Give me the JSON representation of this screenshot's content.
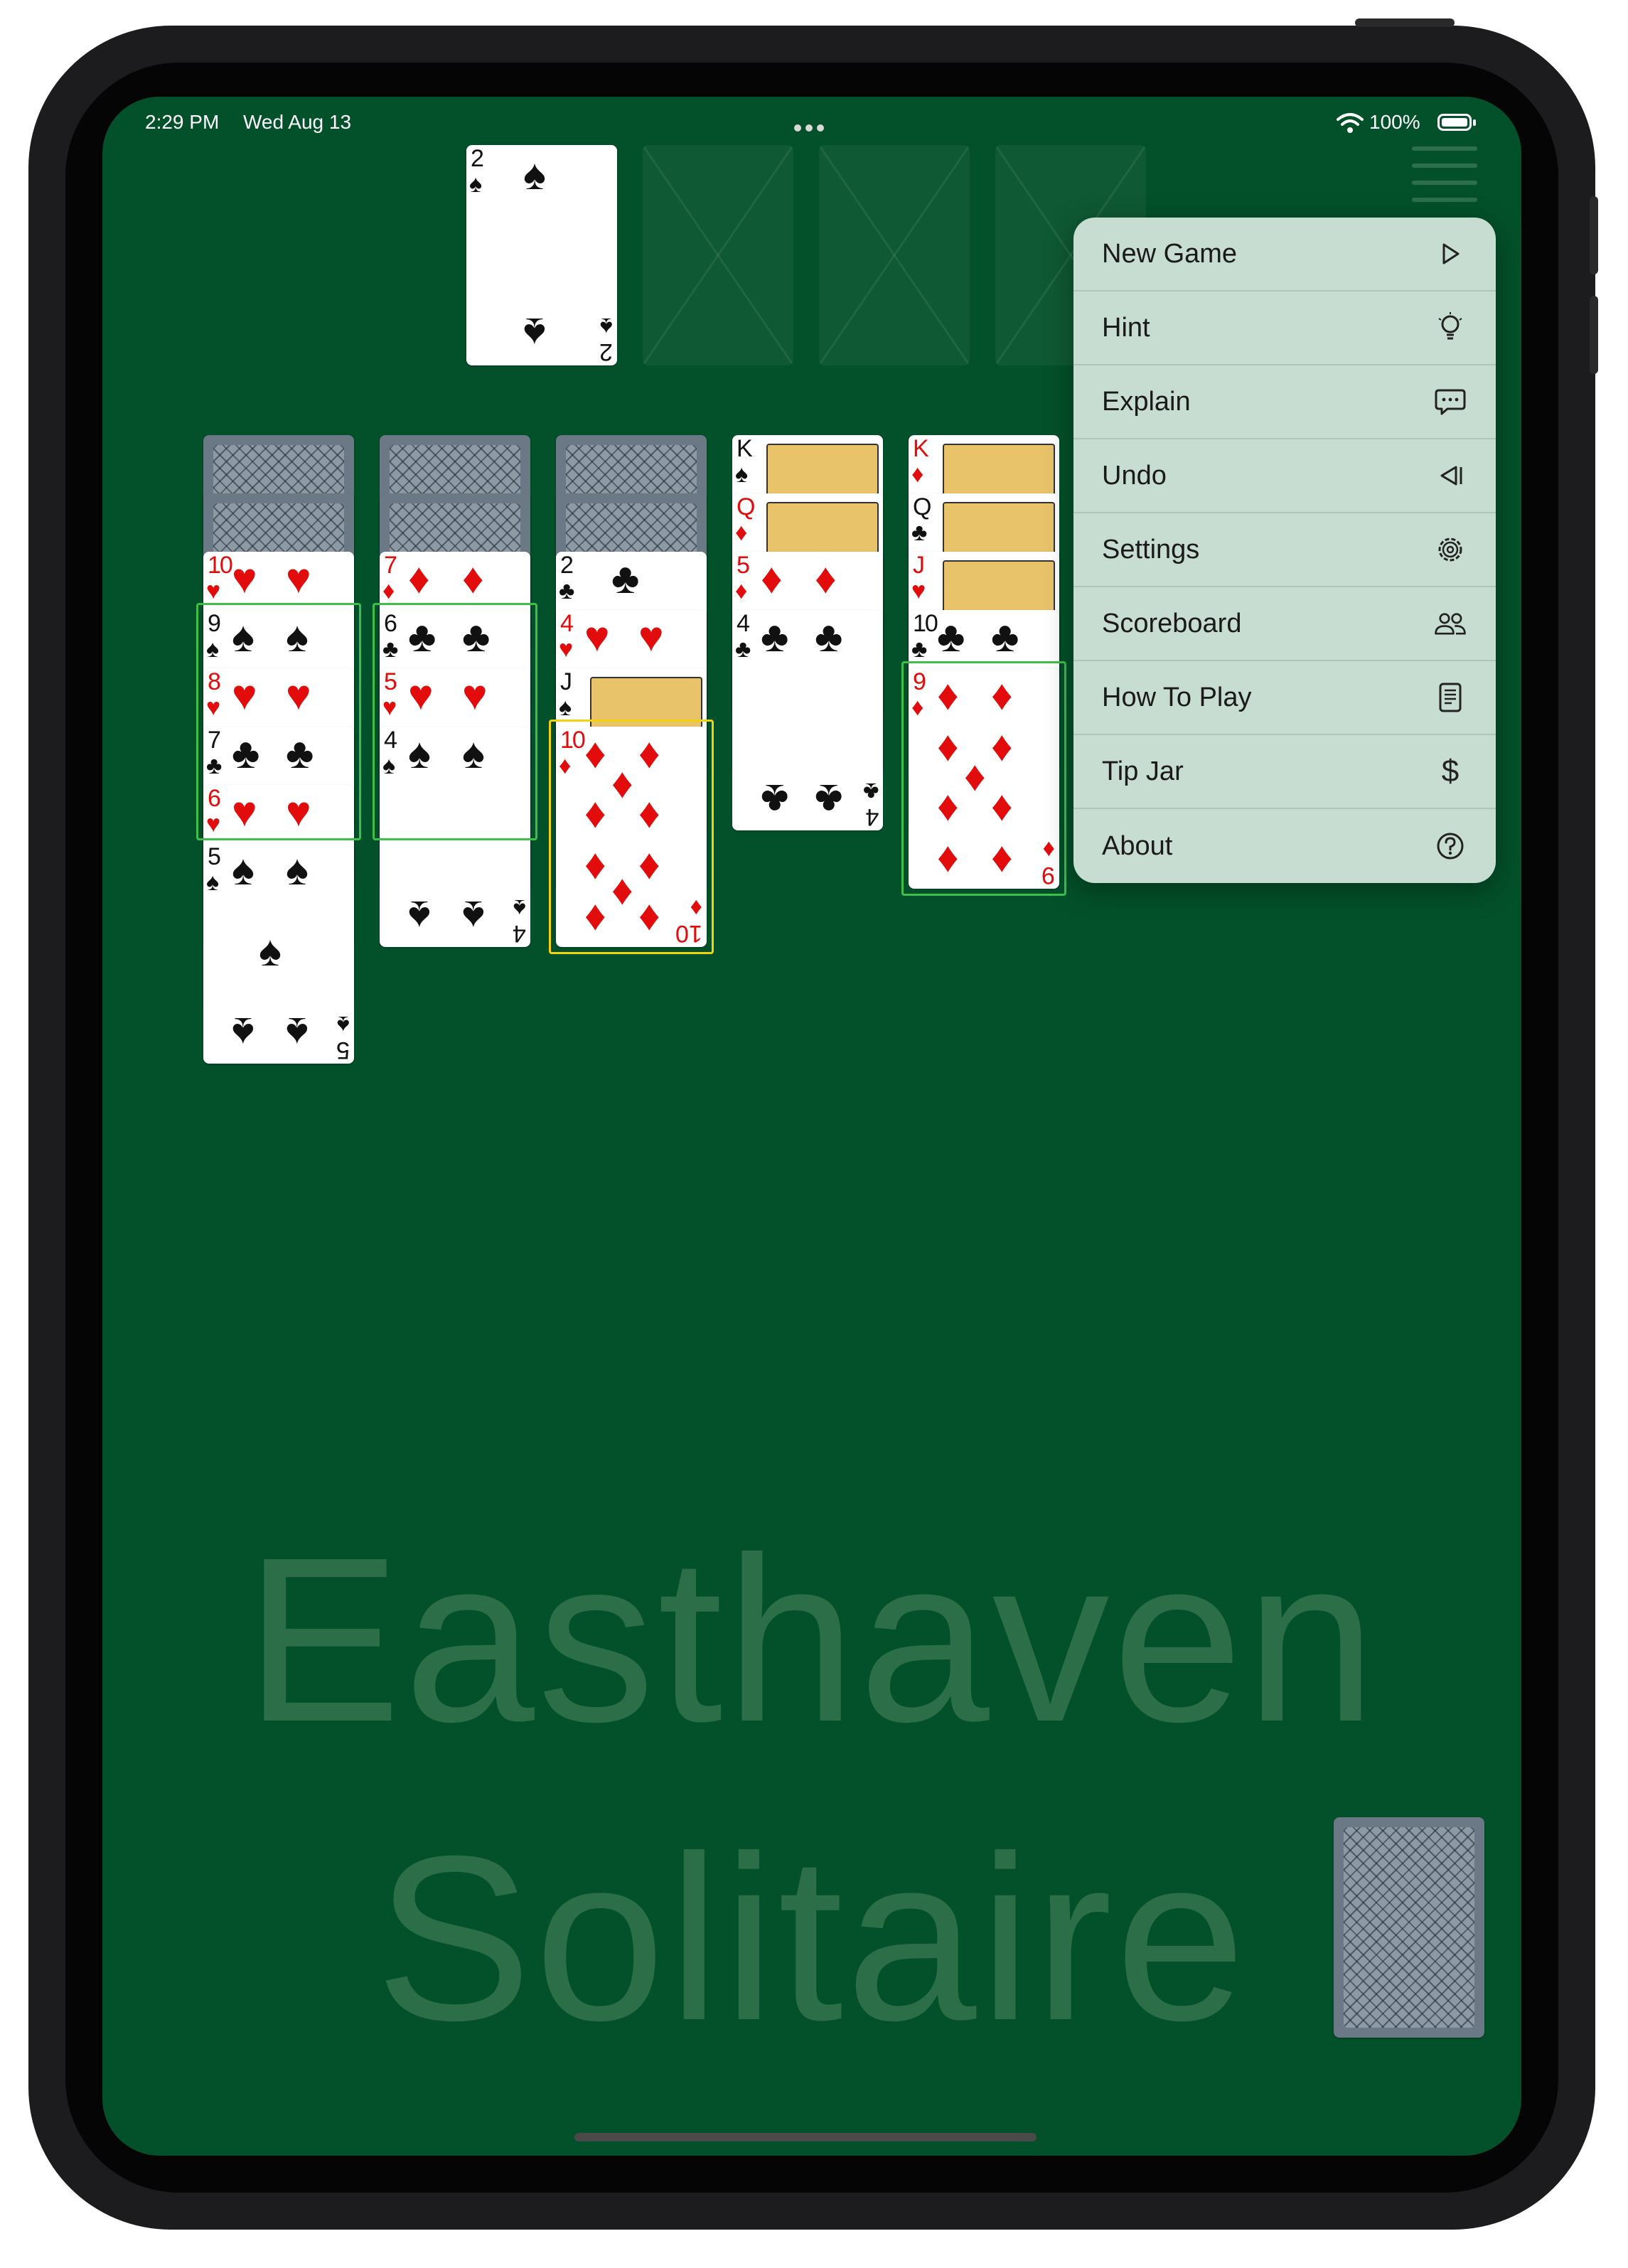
{
  "status": {
    "time": "2:29 PM",
    "date": "Wed Aug 13",
    "battery": "100%"
  },
  "game": {
    "title_line1": "Easthaven",
    "title_line2": "Solitaire"
  },
  "foundation": {
    "card_rank": "2",
    "card_suit": "♠"
  },
  "menu": {
    "items": [
      {
        "label": "New Game",
        "icon": "play-icon"
      },
      {
        "label": "Hint",
        "icon": "lightbulb-icon"
      },
      {
        "label": "Explain",
        "icon": "chat-bubble-icon"
      },
      {
        "label": "Undo",
        "icon": "undo-icon"
      },
      {
        "label": "Settings",
        "icon": "gear-icon"
      },
      {
        "label": "Scoreboard",
        "icon": "people-icon"
      },
      {
        "label": "How To Play",
        "icon": "document-icon"
      },
      {
        "label": "Tip Jar",
        "icon": "dollar-icon"
      },
      {
        "label": "About",
        "icon": "question-icon"
      }
    ]
  },
  "tableau": {
    "col1": [
      "10♥",
      "9♠",
      "8♥",
      "7♣",
      "6♥",
      "5♠"
    ],
    "col2": [
      "7♦",
      "6♣",
      "5♥",
      "4♠"
    ],
    "col3": [
      "2♣",
      "4♥",
      "J♠",
      "10♦"
    ],
    "col4": [
      "K♠",
      "Q♦",
      "5♦",
      "4♣"
    ],
    "col5": [
      "K♦",
      "Q♣",
      "J♥",
      "10♣",
      "9♦"
    ]
  },
  "colors": {
    "felt": "#03512a",
    "red_suit": "#e30c0c",
    "highlight_green": "#3fbf4a",
    "highlight_yellow": "#f2d20d"
  }
}
